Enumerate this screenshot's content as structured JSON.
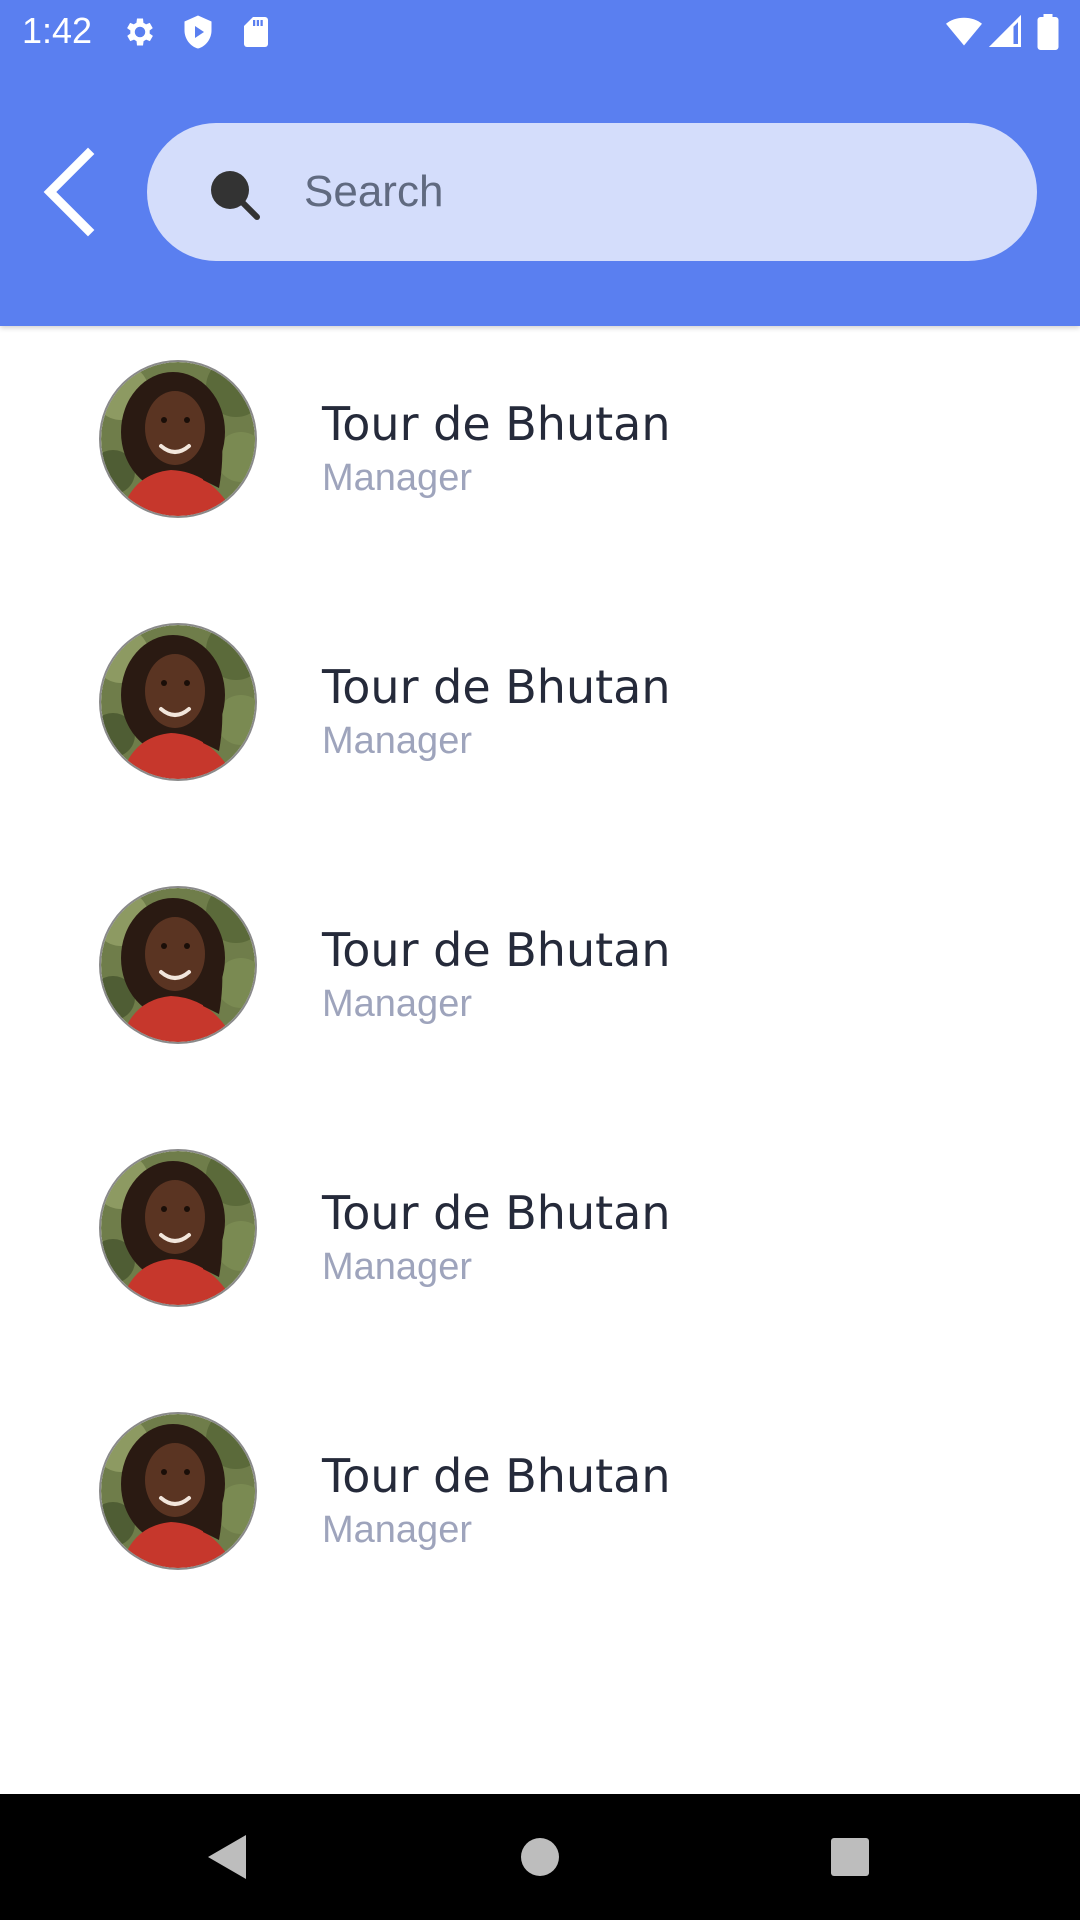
{
  "status_bar": {
    "time": "1:42",
    "icons": [
      "settings-icon",
      "shield-play-icon",
      "sd-card-icon",
      "wifi-icon",
      "cellular-signal-icon",
      "battery-icon"
    ]
  },
  "header": {
    "back_icon": "chevron-left-icon",
    "search": {
      "placeholder": "Search",
      "value": "",
      "icon": "search-icon"
    },
    "accent_color": "#5a7ff0",
    "search_bg_color": "#d4ddfb"
  },
  "contacts": [
    {
      "name": "Tour de Bhutan",
      "role": "Manager"
    },
    {
      "name": "Tour de Bhutan",
      "role": "Manager"
    },
    {
      "name": "Tour de Bhutan",
      "role": "Manager"
    },
    {
      "name": "Tour de Bhutan",
      "role": "Manager"
    },
    {
      "name": "Tour de Bhutan",
      "role": "Manager"
    }
  ],
  "nav_bar": {
    "buttons": [
      "back-triangle-icon",
      "home-circle-icon",
      "recents-square-icon"
    ]
  }
}
